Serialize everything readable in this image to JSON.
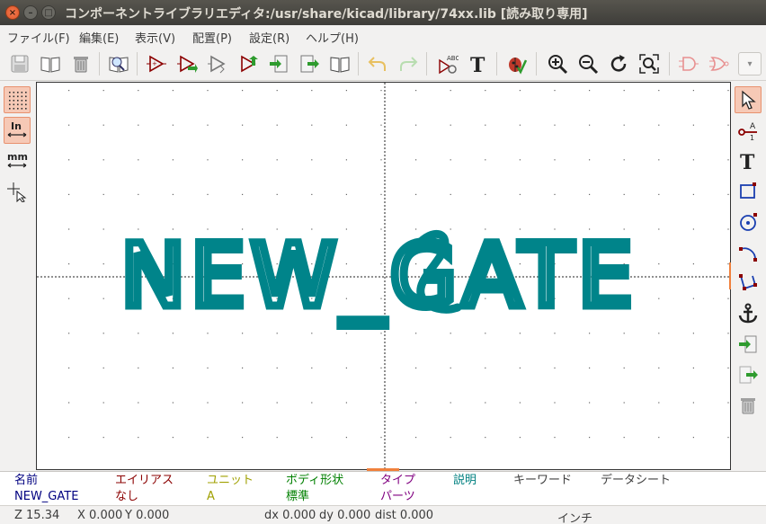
{
  "window": {
    "title": "コンポーネントライブラリエディタ:/usr/share/kicad/library/74xx.lib [読み取り専用]",
    "close_glyph": "×",
    "minimize_glyph": "–",
    "maximize_glyph": "□"
  },
  "menu": [
    {
      "label": "ファイル(F)"
    },
    {
      "label": "編集(E)"
    },
    {
      "label": "表示(V)"
    },
    {
      "label": "配置(P)"
    },
    {
      "label": "設定(R)"
    },
    {
      "label": "ヘルプ(H)"
    }
  ],
  "toolbar": {
    "items": [
      "save-library-icon",
      "library-browser-icon",
      "delete-library-icon",
      "view-library-icon",
      "new-component-icon",
      "load-component-icon",
      "save-component-icon",
      "import-component-icon",
      "export-component-icon",
      "new-library-icon",
      "datasheet-icon",
      "undo-icon",
      "redo-icon",
      "edit-component-properties-icon",
      "edit-fields-icon",
      "erc-check-icon",
      "zoom-in-icon",
      "zoom-out-icon",
      "zoom-redraw-icon",
      "zoom-fit-icon",
      "de-morgan-normal-icon",
      "de-morgan-convert-icon"
    ],
    "text_tool_glyph": "T",
    "abc_text": "ABC",
    "dropdown_glyph": "▾"
  },
  "left_toolbar": {
    "units_inch": "In",
    "units_mm": "mm"
  },
  "right_toolbar": {
    "pin_label": "A",
    "pin_num": "1",
    "text_glyph": "T"
  },
  "canvas": {
    "component_text": "NEW_GATE",
    "text_color": "#00848a"
  },
  "info_panel": {
    "columns": [
      {
        "header": "名前",
        "value": "NEW_GATE",
        "color": "#000080"
      },
      {
        "header": "エイリアス",
        "value": "なし",
        "color": "#8b0000"
      },
      {
        "header": "ユニット",
        "value": "A",
        "color": "#a0a000"
      },
      {
        "header": "ボディ形状",
        "value": "標準",
        "color": "#008000"
      },
      {
        "header": "タイプ",
        "value": "パーツ",
        "color": "#800080"
      },
      {
        "header": "説明",
        "value": "",
        "color": "#008080"
      },
      {
        "header": "キーワード",
        "value": "",
        "color": "#404040"
      },
      {
        "header": "データシート",
        "value": "",
        "color": "#404040"
      }
    ]
  },
  "status": {
    "zoom": "Z 15.34",
    "x": "X 0.000",
    "y": "Y 0.000",
    "dx": "dx 0.000",
    "dy": "dy 0.000",
    "dist": "dist 0.000",
    "units": "インチ"
  }
}
